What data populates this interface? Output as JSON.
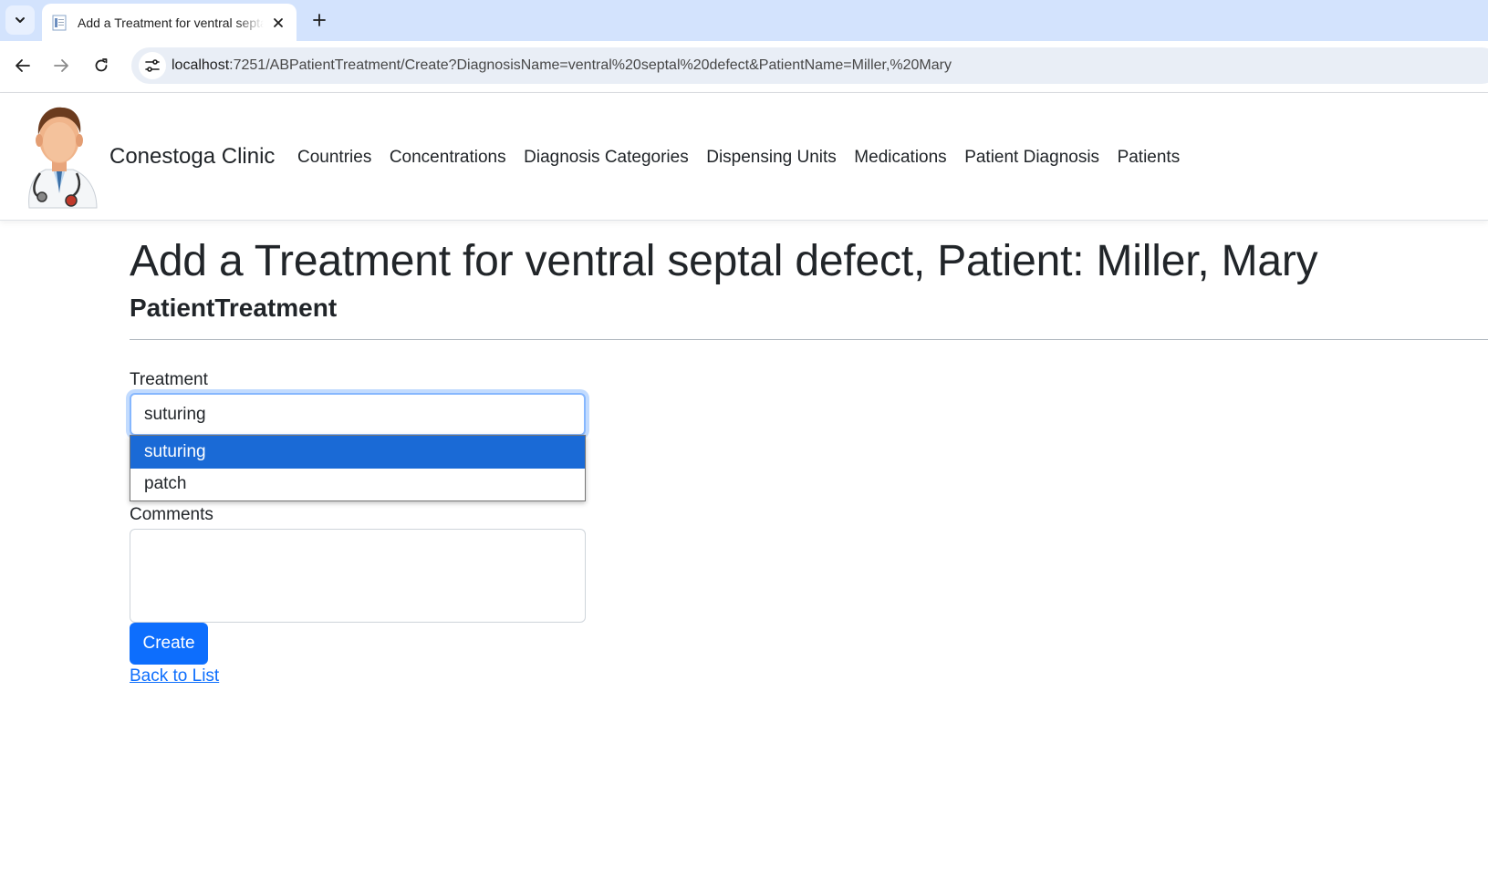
{
  "browser": {
    "tab_title": "Add a Treatment for ventral septal defect, Patient: Miller, Mary",
    "url_host": "localhost",
    "url_rest": ":7251/ABPatientTreatment/Create?DiagnosisName=ventral%20septal%20defect&PatientName=Miller,%20Mary"
  },
  "header": {
    "brand": "Conestoga Clinic",
    "nav": [
      "Countries",
      "Concentrations",
      "Diagnosis Categories",
      "Dispensing Units",
      "Medications",
      "Patient Diagnosis",
      "Patients"
    ]
  },
  "main": {
    "title": "Add a Treatment for ventral septal defect, Patient: Miller, Mary",
    "subtitle": "PatientTreatment",
    "treatment_label": "Treatment",
    "treatment_value": "suturing",
    "treatment_options": [
      "suturing",
      "patch"
    ],
    "comments_label": "Comments",
    "comments_value": "",
    "create_label": "Create",
    "back_label": "Back to List"
  },
  "colors": {
    "primary": "#0d6efd",
    "option_selected": "#1a6ad6",
    "tabstrip": "#d3e3fd"
  }
}
